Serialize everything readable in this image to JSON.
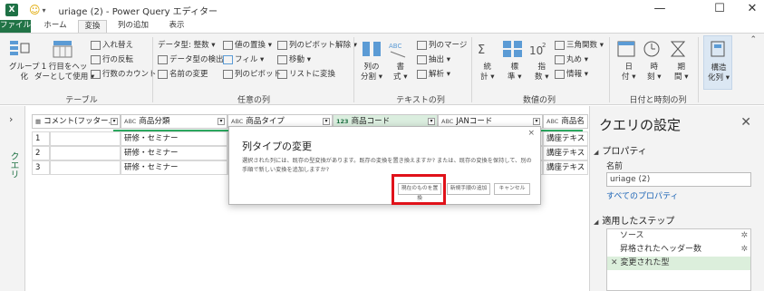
{
  "window": {
    "app_icon": "X",
    "title": "uriage (2) - Power Query エディター",
    "minimize": "—",
    "maximize": "☐",
    "close": "✕"
  },
  "tabs": [
    "ファイル",
    "ホーム",
    "変換",
    "列の追加",
    "表示"
  ],
  "ribbon": {
    "table_group": {
      "group_btn": "グループ化",
      "group_btn_l1": "グループ",
      "group_btn_l2": "化",
      "header_btn_l1": "1 行目をヘッ",
      "header_btn_l2": "ダーとして使用 ▾",
      "transpose": "入れ替え",
      "reverse_rows": "行の反転",
      "count_rows": "行数のカウント",
      "label": "テーブル"
    },
    "any_column": {
      "data_type": "データ型: 整数 ▾",
      "detect_type": "データ型の検出",
      "rename": "名前の変更",
      "replace_values": "値の置換 ▾",
      "fill": "フィル ▾",
      "pivot": "列のピボット",
      "unpivot": "列のピボット解除 ▾",
      "move": "移動 ▾",
      "to_list": "リストに変換",
      "label": "任意の列"
    },
    "text_column": {
      "split_l1": "列の",
      "split_l2": "分割 ▾",
      "format_l1": "書",
      "format_l2": "式 ▾",
      "merge": "列のマージ",
      "extract": "抽出 ▾",
      "parse": "解析 ▾",
      "label": "テキストの列"
    },
    "number_column": {
      "stats_l1": "統",
      "stats_l2": "計 ▾",
      "standard_l1": "標",
      "standard_l2": "準 ▾",
      "scientific_l1": "指",
      "scientific_l2": "数 ▾",
      "trig": "三角関数 ▾",
      "rounding": "丸め ▾",
      "info": "情報 ▾",
      "label": "数値の列"
    },
    "datetime_column": {
      "date_l1": "日",
      "date_l2": "付 ▾",
      "time_l1": "時",
      "time_l2": "刻 ▾",
      "duration_l1": "期",
      "duration_l2": "間 ▾",
      "label": "日付と時刻の列"
    },
    "structured": {
      "label_l1": "構造",
      "label_l2": "化列 ▾"
    }
  },
  "left_pane": {
    "expand": "›",
    "label": "クエリ"
  },
  "grid": {
    "headers": [
      {
        "type": "▦",
        "name": "コメント(フッター..."
      },
      {
        "type": "ABC",
        "name": "商品分類"
      },
      {
        "type": "ABC",
        "name": "商品タイプ"
      },
      {
        "type": "123",
        "name": "商品コード"
      },
      {
        "type": "ABC",
        "name": "JANコード"
      },
      {
        "type": "ABC",
        "name": "商品名"
      }
    ],
    "rows": [
      {
        "num": "1",
        "cat": "研修・セミナー",
        "last": "講座テキス"
      },
      {
        "num": "2",
        "cat": "研修・セミナー",
        "last": "講座テキス"
      },
      {
        "num": "3",
        "cat": "研修・セミナー",
        "last": "講座テキス"
      }
    ]
  },
  "dialog": {
    "title": "列タイプの変更",
    "close": "×",
    "message": "選択された列には、既存の型変換があります。既存の変換を置き換えますか? または、既存の変換を保持して、別の手順で新しい変換を追加しますか?",
    "btn_replace": "現在のものを置換",
    "btn_add_step": "新規手順の追加",
    "btn_cancel": "キャンセル"
  },
  "query_settings": {
    "title": "クエリの設定",
    "close": "✕",
    "properties_heading": "プロパティ",
    "name_label": "名前",
    "name_value": "uriage (2)",
    "all_properties_link": "すべてのプロパティ",
    "steps_heading": "適用したステップ",
    "steps": [
      {
        "label": "ソース",
        "gear": "✲"
      },
      {
        "label": "昇格されたヘッダー数",
        "gear": "✲"
      },
      {
        "label": "変更された型",
        "prefix": "✕"
      }
    ]
  },
  "colors": {
    "excel_green": "#217346",
    "highlight_red": "#e0121a",
    "selected_step": "#dcefdc",
    "link_blue": "#1a63b5"
  }
}
